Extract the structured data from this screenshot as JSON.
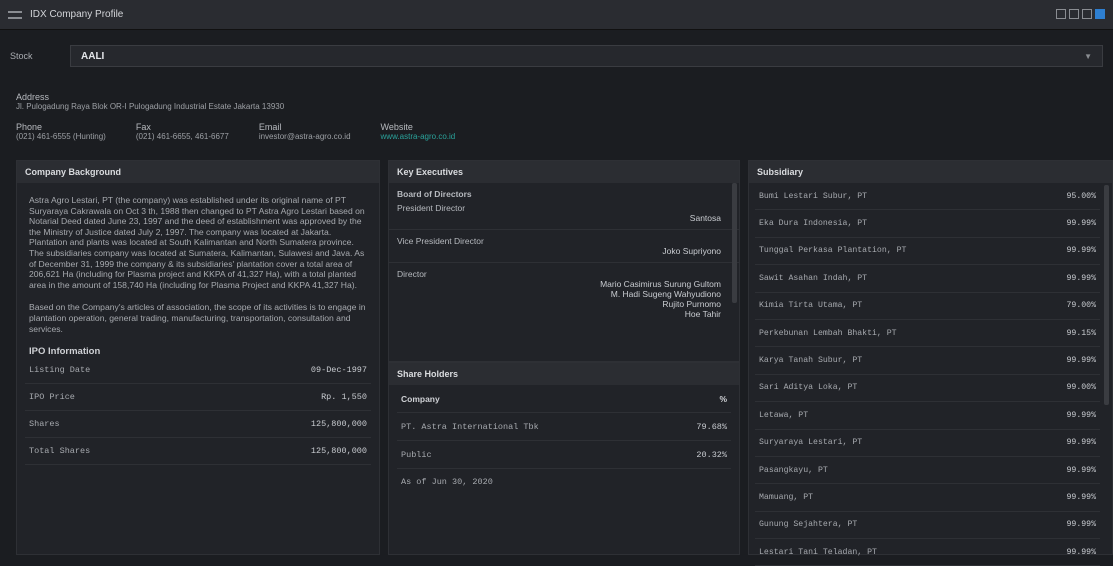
{
  "window": {
    "title": "IDX Company Profile"
  },
  "stock": {
    "label": "Stock",
    "value": "AALI"
  },
  "address": {
    "label": "Address",
    "value": "Jl. Pulogadung Raya Blok OR-I Pulogadung Industrial Estate Jakarta 13930"
  },
  "contacts": [
    {
      "label": "Phone",
      "value": "(021) 461-6555 (Hunting)"
    },
    {
      "label": "Fax",
      "value": "(021) 461-6655, 461-6677"
    },
    {
      "label": "Email",
      "value": "investor@astra-agro.co.id"
    },
    {
      "label": "Website",
      "value": "www.astra-agro.co.id"
    }
  ],
  "background": {
    "title": "Company Background",
    "paragraphs": [
      "Astra Agro Lestari, PT (the company) was established under its original name of PT Suryaraya Cakrawala on Oct 3 th, 1988 then changed to PT Astra Agro Lestari based on Notarial Deed dated June 23, 1997 and the deed of establishment was approved by the the Ministry of Justice dated July 2, 1997. The company was located at Jakarta. Plantation and plants was located at South Kalimantan and North Sumatera province. The subsidiaries company was located at Sumatera, Kalimantan, Sulawesi and Java. As of December 31, 1999 the company & its subsidiaries' plantation cover a total area of 206,621 Ha (including for Plasma project and KKPA of 41,327 Ha), with a total planted area in the amount of 158,740 Ha (including for Plasma Project and KKPA 41,327 Ha).",
      "Based on the Company's articles of association, the scope of its activities is to engage in plantation operation, general trading, manufacturing, transportation, consultation and services."
    ]
  },
  "ipo": {
    "title": "IPO Information",
    "rows": [
      {
        "label": "Listing Date",
        "value": "09-Dec-1997"
      },
      {
        "label": "IPO Price",
        "value": "Rp. 1,550"
      },
      {
        "label": "Shares",
        "value": "125,800,000"
      },
      {
        "label": "Total Shares",
        "value": "125,800,000"
      }
    ]
  },
  "executives": {
    "title": "Key Executives",
    "board_title": "Board of Directors",
    "sections": [
      {
        "heading": "President Director",
        "names": [
          "Santosa"
        ]
      },
      {
        "heading": "Vice President Director",
        "names": [
          "Joko Supriyono"
        ]
      },
      {
        "heading": "Director",
        "names": [
          "Mario Casimirus Surung Gultom",
          "M. Hadi Sugeng Wahyudiono",
          "Rujito Purnomo",
          "Hoe Tahir"
        ]
      }
    ]
  },
  "shareholders": {
    "title": "Share Holders",
    "col_company": "Company",
    "col_pct": "%",
    "rows": [
      {
        "name": "PT. Astra International Tbk",
        "pct": "79.68%"
      },
      {
        "name": "Public",
        "pct": "20.32%"
      }
    ],
    "note": "As of Jun 30, 2020"
  },
  "subsidiary": {
    "title": "Subsidiary",
    "rows": [
      {
        "name": "Bumi Lestari Subur, PT",
        "pct": "95.00%"
      },
      {
        "name": "Eka Dura Indonesia, PT",
        "pct": "99.99%"
      },
      {
        "name": "Tunggal Perkasa Plantation, PT",
        "pct": "99.99%"
      },
      {
        "name": "Sawit Asahan Indah, PT",
        "pct": "99.99%"
      },
      {
        "name": "Kimia Tirta Utama, PT",
        "pct": "79.00%"
      },
      {
        "name": "Perkebunan Lembah Bhakti, PT",
        "pct": "99.15%"
      },
      {
        "name": "Karya Tanah Subur, PT",
        "pct": "99.99%"
      },
      {
        "name": "Sari Aditya Loka, PT",
        "pct": "99.00%"
      },
      {
        "name": "Letawa, PT",
        "pct": "99.99%"
      },
      {
        "name": "Suryaraya Lestari, PT",
        "pct": "99.99%"
      },
      {
        "name": "Pasangkayu, PT",
        "pct": "99.99%"
      },
      {
        "name": "Mamuang, PT",
        "pct": "99.99%"
      },
      {
        "name": "Gunung Sejahtera, PT",
        "pct": "99.99%"
      },
      {
        "name": "Lestari Tani Teladan, PT",
        "pct": "99.99%"
      }
    ]
  }
}
